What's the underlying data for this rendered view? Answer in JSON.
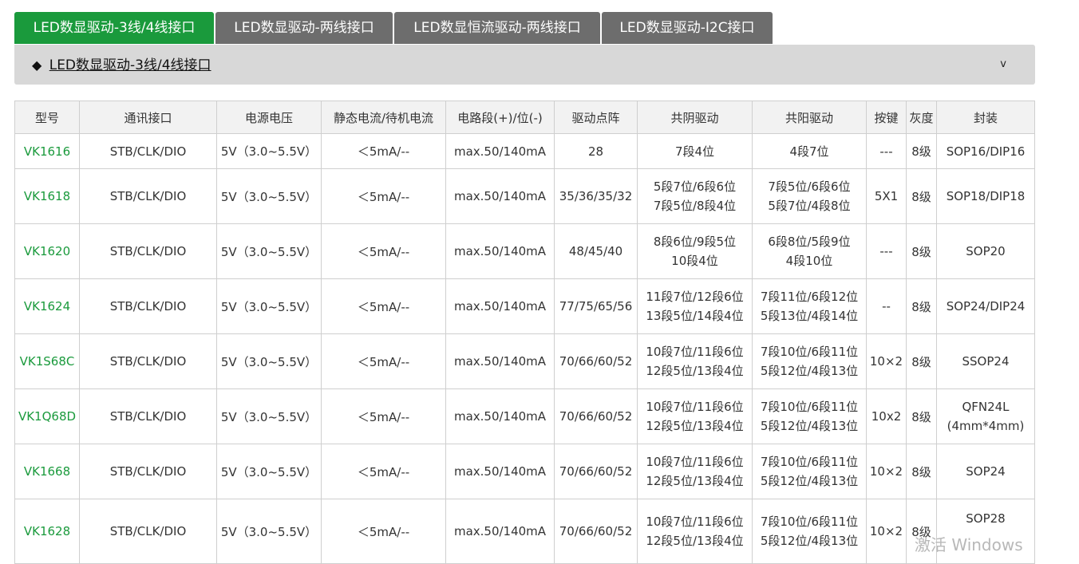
{
  "tabs": [
    {
      "label": "LED数显驱动-3线/4线接口",
      "active": true
    },
    {
      "label": "LED数显驱动-两线接口",
      "active": false
    },
    {
      "label": "LED数显恒流驱动-两线接口",
      "active": false
    },
    {
      "label": "LED数显驱动-I2C接口",
      "active": false
    }
  ],
  "accordion": {
    "bullet": "◆",
    "title": "LED数显驱动-3线/4线接口",
    "chevron": "v"
  },
  "table": {
    "headers": [
      "型号",
      "通讯接口",
      "电源电压",
      "静态电流/待机电流",
      "电路段(+)/位(-)",
      "驱动点阵",
      "共阴驱动",
      "共阳驱动",
      "按键",
      "灰度",
      "封装"
    ],
    "rows": [
      {
        "model": "VK1616",
        "interface": "STB/CLK/DIO",
        "voltage": "5V（3.0~5.5V）",
        "current": "＜5mA/--",
        "segment": "max.50/140mA",
        "matrix": "28",
        "cathode": [
          "7段4位"
        ],
        "anode": [
          "4段7位"
        ],
        "keys": "---",
        "gray": "8级",
        "package": [
          "SOP16/DIP16"
        ]
      },
      {
        "model": "VK1618",
        "interface": "STB/CLK/DIO",
        "voltage": "5V（3.0~5.5V）",
        "current": "＜5mA/--",
        "segment": "max.50/140mA",
        "matrix": "35/36/35/32",
        "cathode": [
          "5段7位/6段6位",
          "7段5位/8段4位"
        ],
        "anode": [
          "7段5位/6段6位",
          "5段7位/4段8位"
        ],
        "keys": "5X1",
        "gray": "8级",
        "package": [
          "SOP18/DIP18"
        ]
      },
      {
        "model": "VK1620",
        "interface": "STB/CLK/DIO",
        "voltage": "5V（3.0~5.5V）",
        "current": "＜5mA/--",
        "segment": "max.50/140mA",
        "matrix": "48/45/40",
        "cathode": [
          "8段6位/9段5位",
          "10段4位"
        ],
        "anode": [
          "6段8位/5段9位",
          "4段10位"
        ],
        "keys": "---",
        "gray": "8级",
        "package": [
          "SOP20"
        ]
      },
      {
        "model": "VK1624",
        "interface": "STB/CLK/DIO",
        "voltage": "5V（3.0~5.5V）",
        "current": "＜5mA/--",
        "segment": "max.50/140mA",
        "matrix": "77/75/65/56",
        "cathode": [
          "11段7位/12段6位",
          "13段5位/14段4位"
        ],
        "anode": [
          "7段11位/6段12位",
          "5段13位/4段14位"
        ],
        "keys": "--",
        "gray": "8级",
        "package": [
          "SOP24/DIP24"
        ]
      },
      {
        "model": "VK1S68C",
        "interface": "STB/CLK/DIO",
        "voltage": "5V（3.0~5.5V）",
        "current": "＜5mA/--",
        "segment": "max.50/140mA",
        "matrix": "70/66/60/52",
        "cathode": [
          "10段7位/11段6位",
          "12段5位/13段4位"
        ],
        "anode": [
          "7段10位/6段11位",
          "5段12位/4段13位"
        ],
        "keys": "10×2",
        "gray": "8级",
        "package": [
          "SSOP24"
        ]
      },
      {
        "model": "VK1Q68D",
        "interface": "STB/CLK/DIO",
        "voltage": "5V（3.0~5.5V）",
        "current": "＜5mA/--",
        "segment": "max.50/140mA",
        "matrix": "70/66/60/52",
        "cathode": [
          "10段7位/11段6位",
          "12段5位/13段4位"
        ],
        "anode": [
          "7段10位/6段11位",
          "5段12位/4段13位"
        ],
        "keys": "10x2",
        "gray": "8级",
        "package": [
          "QFN24L",
          "(4mm*4mm)"
        ]
      },
      {
        "model": "VK1668",
        "interface": "STB/CLK/DIO",
        "voltage": "5V（3.0~5.5V）",
        "current": "＜5mA/--",
        "segment": "max.50/140mA",
        "matrix": "70/66/60/52",
        "cathode": [
          "10段7位/11段6位",
          "12段5位/13段4位"
        ],
        "anode": [
          "7段10位/6段11位",
          "5段12位/4段13位"
        ],
        "keys": "10×2",
        "gray": "8级",
        "package": [
          "SOP24"
        ]
      },
      {
        "model": "VK1628",
        "interface": "STB/CLK/DIO",
        "voltage": "5V（3.0~5.5V）",
        "current": "＜5mA/--",
        "segment": "max.50/140mA",
        "matrix": "70/66/60/52",
        "cathode": [
          "10段7位/11段6位",
          "12段5位/13段4位"
        ],
        "anode": [
          "7段10位/6段11位",
          "5段12位/4段13位"
        ],
        "keys": "10×2",
        "gray": "8级",
        "package": [
          "SOP28"
        ]
      }
    ]
  },
  "watermark": "激活 Windows",
  "colors": {
    "accent": "#1a9a3c",
    "tab_inactive": "#6d6d6d",
    "accordion_bg": "#d8d8d8",
    "header_bg": "#f2f2f2"
  }
}
